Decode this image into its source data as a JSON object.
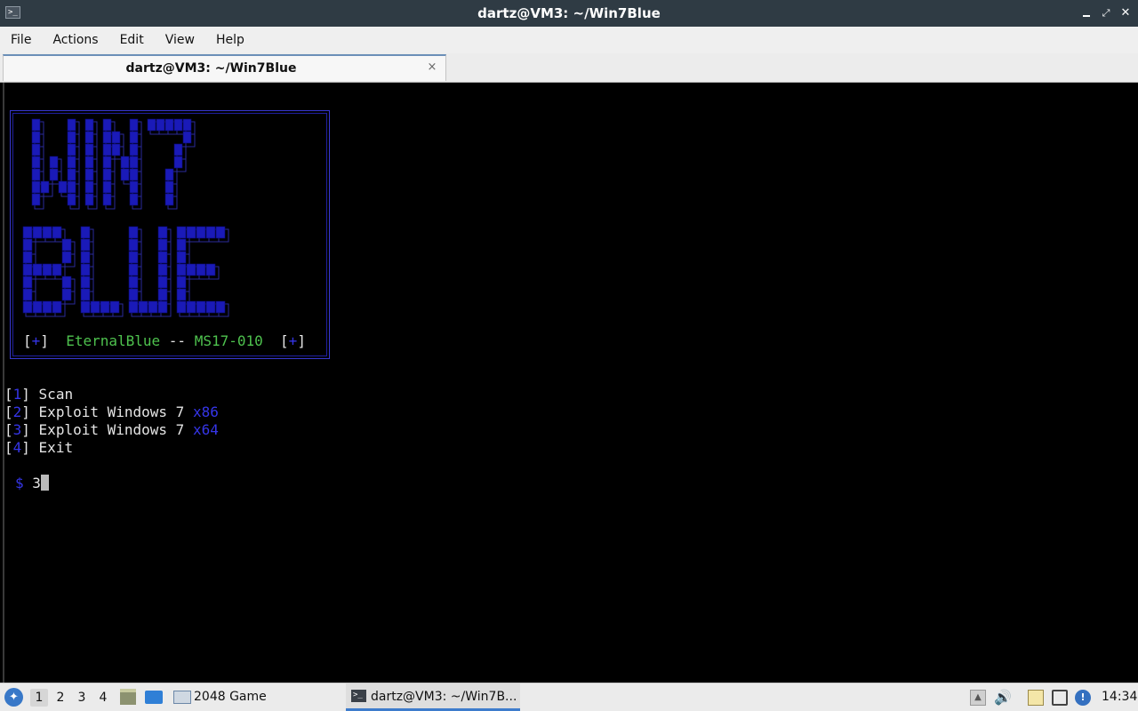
{
  "window": {
    "title": "dartz@VM3: ~/Win7Blue",
    "app_icon_glyph": ">_",
    "minimize_icon": "minimize-icon",
    "restore_icon": "restore-icon",
    "close_icon": "close-icon"
  },
  "menubar": {
    "items": [
      "File",
      "Actions",
      "Edit",
      "View",
      "Help"
    ]
  },
  "tabs": [
    {
      "label": "dartz@VM3: ~/Win7Blue",
      "close_glyph": "×",
      "active": true
    }
  ],
  "terminal": {
    "banner": {
      "art_text": [
        "WIN7",
        "BLUE"
      ],
      "footer": {
        "bracket_open": "[",
        "bullet": "+",
        "bracket_close": "]",
        "name": "EternalBlue",
        "sep": "--",
        "id": "MS17-010"
      }
    },
    "options": [
      {
        "num": "1",
        "text": "Scan",
        "arch": ""
      },
      {
        "num": "2",
        "text": "Exploit Windows 7",
        "arch": "x86"
      },
      {
        "num": "3",
        "text": "Exploit Windows 7",
        "arch": "x64"
      },
      {
        "num": "4",
        "text": "Exit",
        "arch": ""
      }
    ],
    "prompt_symbol": "$",
    "input_value": "3"
  },
  "taskbar": {
    "workspaces": [
      "1",
      "2",
      "3",
      "4"
    ],
    "active_workspace": "1",
    "tasks": [
      {
        "label": "2048 Game",
        "icon": "window-icon"
      },
      {
        "label": "dartz@VM3: ~/Win7B...",
        "icon": "terminal-icon",
        "active": true
      }
    ],
    "clock": "14:34"
  },
  "colors": {
    "banner_blue": "#1a1ab8",
    "green_text": "#4ec24e",
    "titlebar_bg": "#2f3b44"
  }
}
